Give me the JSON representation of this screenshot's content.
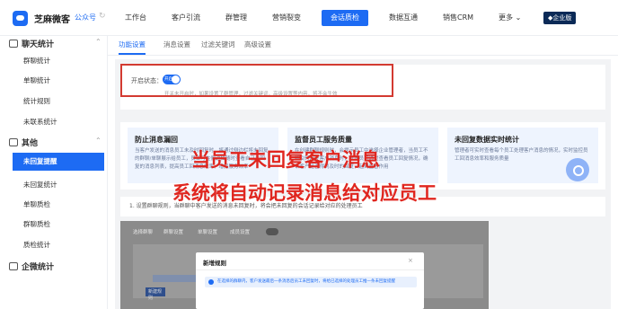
{
  "header": {
    "brand": "芝麻微客",
    "public_account": "公众号",
    "nav": [
      "工作台",
      "客户引流",
      "群管理",
      "营销裂变",
      "会话质检",
      "数据互通",
      "销售CRM",
      "更多 ⌄"
    ],
    "nav_active_index": 4,
    "enterprise_badge": "◆企业版",
    "accent_color": "#1d6bf3"
  },
  "sidebar": {
    "groups": [
      {
        "label": "聊天统计",
        "icon": "chat-stats-icon",
        "items": [
          "群聊统计",
          "单聊统计",
          "统计规则",
          "未联系统计"
        ]
      },
      {
        "label": "其他",
        "icon": "other-icon",
        "items": [
          "未回复提醒",
          "未回复统计",
          "单聊质检",
          "群聊质检",
          "质检统计"
        ]
      },
      {
        "label": "企微统计",
        "icon": "wecom-stats-icon",
        "items": []
      }
    ],
    "active_item": "未回复提醒"
  },
  "tabs": [
    "功能设置",
    "消息设置",
    "过滤关键词",
    "高级设置"
  ],
  "status": {
    "label": "开启状态：",
    "toggle_text": "开启",
    "toggle_on": true,
    "hint": "开关未开启时，如果设置了群管理，过滤关键词，高级设置等内容，将不会生效"
  },
  "features": [
    {
      "title": "防止消息漏回",
      "desc": "当客户发送的消息员工未及时回复时，将通过侧边栏将未回复的群聊/单聊展示给员工，员工可在侧边栏随时查看自己未回复的消息列表，提高员工回消息效率，增加服务效率"
    },
    {
      "title": "监督员工服务质量",
      "desc": "在创建群聊规则时，会提示员工中选择企业管理者，当员工不能及时回复客户消息时，管理员可通过查看员工回复情况，确认客户是否得到及时的回复，起到监督作用"
    },
    {
      "title": "未回复数据实时统计",
      "desc": "管理者可实时查看每个员工处理客户消息的情况，实时监控员工回消息效率和服务质量"
    }
  ],
  "rule_desc": "1. 设置群聊规则，当群聊中客户发送的消息未回复时，将会把未回复的会话记录给对应的处理员工",
  "background_panel": {
    "tabs": [
      "选择群聊",
      "群聊设置",
      "单聊设置",
      "成员设置"
    ],
    "button": "新建规则"
  },
  "modal": {
    "title": "新增规则",
    "close": "×",
    "info": "在选择的群聊内，客户发送最后一条消息后员工未回复时，将给已选择的处理员工推一条未回复提醒"
  },
  "overlay": {
    "line1": "当员工未回复客户消息",
    "line2": "系统将自动记录消息给对应员工",
    "color": "#e0261f"
  }
}
